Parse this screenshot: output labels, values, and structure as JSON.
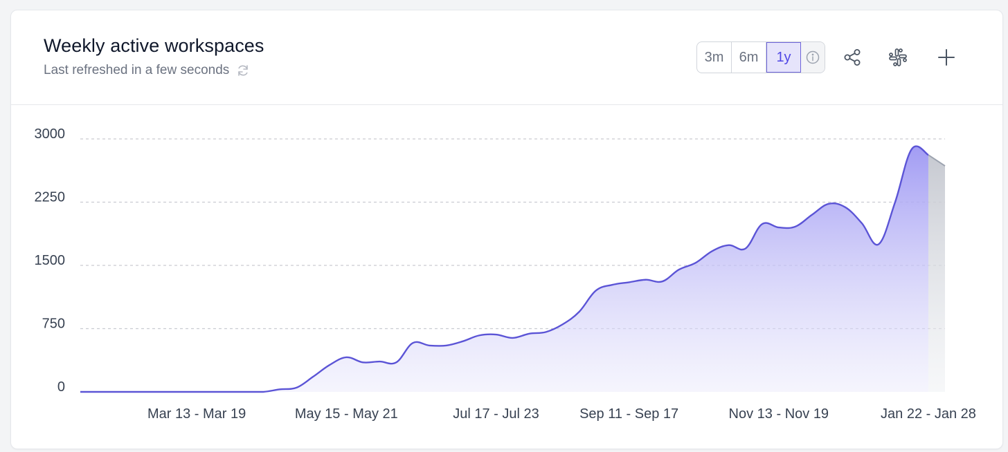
{
  "header": {
    "title": "Weekly active workspaces",
    "subtitle": "Last refreshed in a few seconds",
    "range_options": [
      "3m",
      "6m",
      "1y"
    ],
    "active_range": "1y"
  },
  "colors": {
    "line": "#5b54d6",
    "fill_top": "#9d97f3",
    "incomplete": "#c4c7cf",
    "grid": "#c9cbd1",
    "text": "#374151"
  },
  "chart_data": {
    "type": "area",
    "title": "Weekly active workspaces",
    "ylim": [
      0,
      3000
    ],
    "yticks": [
      0,
      750,
      1500,
      2250,
      3000
    ],
    "xtick_labels": [
      "Mar 13 - Mar 19",
      "May 15 - May 21",
      "Jul 17 - Jul 23",
      "Sep 11 - Sep 17",
      "Nov 13 - Nov 19",
      "Jan 22 - Jan 28"
    ],
    "xtick_week_index": [
      7,
      16,
      25,
      33,
      42,
      51
    ],
    "grid": "horizontal dashed",
    "incomplete_last_period": true,
    "series": [
      {
        "values": [
          0,
          0,
          0,
          0,
          0,
          0,
          0,
          0,
          0,
          0,
          0,
          0,
          30,
          50,
          180,
          320,
          410,
          350,
          360,
          350,
          580,
          550,
          550,
          600,
          670,
          680,
          640,
          690,
          710,
          800,
          950,
          1200,
          1270,
          1300,
          1330,
          1310,
          1450,
          1530,
          1670,
          1740,
          1700,
          1990,
          1950,
          1960,
          2100,
          2230,
          2190,
          2000,
          1750,
          2250,
          2880,
          2810,
          2680
        ]
      }
    ]
  }
}
